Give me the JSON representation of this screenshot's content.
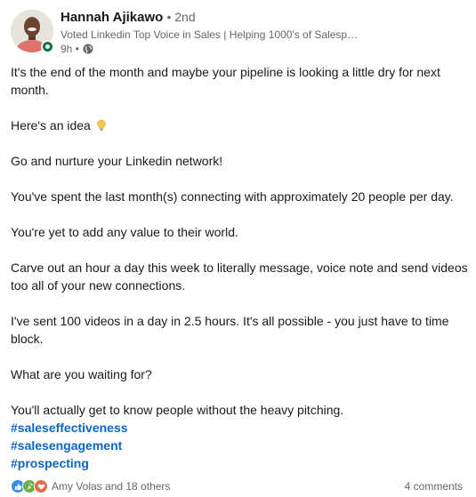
{
  "author": {
    "name": "Hannah Ajikawo",
    "degree": "• 2nd",
    "headline": "Voted Linkedin Top Voice in Sales | Helping 1000's of Salesp…",
    "time": "9h •",
    "visibility_icon": "globe-icon",
    "status": "online"
  },
  "post": {
    "paragraphs": [
      "It's the end of the month and maybe your pipeline is looking a little dry for next month.",
      "Here's an idea",
      "Go and nurture your Linkedin network!",
      "You've spent the last month(s) connecting with approximately 20 people per day.",
      "You're yet to add any value to their world.",
      "Carve out an hour a day this week to literally message, voice note and send videos too all of your new connections.",
      "I've sent 100 videos in a day in 2.5 hours. It's all possible - you just have to time block.",
      "What are you waiting for?",
      "You'll actually get to know people without the heavy pitching."
    ],
    "idea_emoji": "💡",
    "hashtags": [
      "#saleseffectiveness",
      "#salesengagement",
      "#prospecting"
    ]
  },
  "social": {
    "reactions_text": "Amy Volas and 18 others",
    "reaction_icons": [
      "like-icon",
      "celebrate-icon",
      "love-icon"
    ],
    "comments_text": "4 comments"
  },
  "colors": {
    "link": "#0a66c2",
    "secondary_text": "#666666",
    "online": "#057642"
  }
}
